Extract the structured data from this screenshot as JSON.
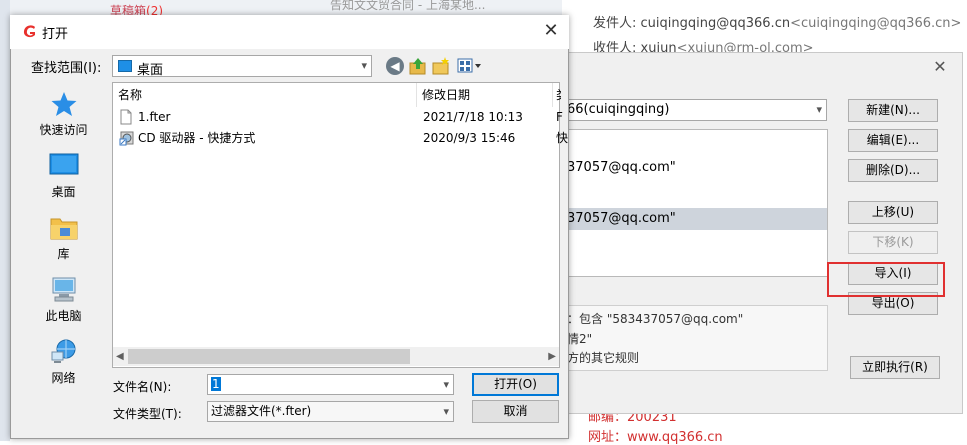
{
  "background_mail": {
    "top_clip_left": "草稿箱",
    "top_clip_badge": "(2)",
    "top_clip_subject": "告知文文贸合同 - 上海某地...",
    "sender_label": "发件人:",
    "sender_name": "cuiqingqing@qq366.cn",
    "sender_addr": "<cuiqingqing@qq366.cn>",
    "recipient_label": "收件人:",
    "recipient_name": "xujun",
    "recipient_addr": "<xujun@rm-ol.com>",
    "footer_postcode": "邮编：200231",
    "footer_url": "网址：www.qq366.cn"
  },
  "filter_dialog": {
    "account_select": "66(cuiqingqing)",
    "rules": [
      "37057@qq.com\"",
      "37057@qq.com\""
    ],
    "description_lines": [
      "：包含 \"583437057@qq.com\"",
      "情2\"",
      "方的其它规则"
    ],
    "buttons": {
      "new": "新建(N)...",
      "edit": "编辑(E)...",
      "delete": "删除(D)...",
      "move_up": "上移(U)",
      "move_down": "下移(K)",
      "import": "导入(I)",
      "export": "导出(O)",
      "run_now": "立即执行(R)"
    },
    "highlight_color": "#e03030"
  },
  "open_dialog": {
    "title": "打开",
    "lookin_label": "查找范围(I):",
    "lookin_value": "桌面",
    "places": [
      {
        "label": "快速访问",
        "icon": "star-icon"
      },
      {
        "label": "桌面",
        "icon": "desktop-icon"
      },
      {
        "label": "库",
        "icon": "library-folder-icon"
      },
      {
        "label": "此电脑",
        "icon": "computer-icon"
      },
      {
        "label": "网络",
        "icon": "network-icon"
      }
    ],
    "columns": {
      "name": "名称",
      "date": "修改日期",
      "extra": "类"
    },
    "files": [
      {
        "name": "1.fter",
        "date": "2021/7/18 10:13",
        "extra": "F",
        "icon": "file-icon"
      },
      {
        "name": "CD 驱动器 - 快捷方式",
        "date": "2020/9/3 15:46",
        "extra": "快",
        "icon": "cd-shortcut-icon"
      }
    ],
    "filename_label": "文件名(N):",
    "filename_value": "1",
    "filetype_label": "文件类型(T):",
    "filetype_value": "过滤器文件(*.fter)",
    "open_button": "打开(O)",
    "cancel_button": "取消",
    "accent": "#0078d7"
  }
}
